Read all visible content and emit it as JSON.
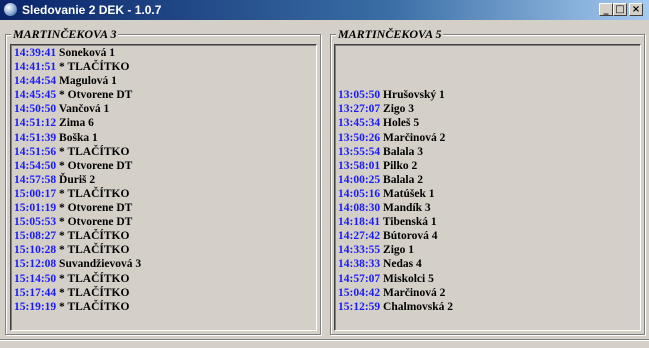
{
  "window": {
    "title": "Sledovanie 2 DEK - 1.0.7",
    "minimize": "_",
    "maximize": "□",
    "close": "×"
  },
  "left": {
    "label": "MARTINČEKOVA 3",
    "blank_top_rows": 0,
    "rows": [
      {
        "time": "14:39:41",
        "name": "Soneková 1"
      },
      {
        "time": "14:41:51",
        "name": "* TLAČÍTKO"
      },
      {
        "time": "14:44:54",
        "name": "Magulová 1"
      },
      {
        "time": "14:45:45",
        "name": "* Otvorene DT"
      },
      {
        "time": "14:50:50",
        "name": "Vančová 1"
      },
      {
        "time": "14:51:12",
        "name": "Zima 6"
      },
      {
        "time": "14:51:39",
        "name": "Boška 1"
      },
      {
        "time": "14:51:56",
        "name": "* TLAČÍTKO"
      },
      {
        "time": "14:54:50",
        "name": "* Otvorene DT"
      },
      {
        "time": "14:57:58",
        "name": "Ďuriš 2"
      },
      {
        "time": "15:00:17",
        "name": "* TLAČÍTKO"
      },
      {
        "time": "15:01:19",
        "name": "* Otvorene DT"
      },
      {
        "time": "15:05:53",
        "name": "* Otvorene DT"
      },
      {
        "time": "15:08:27",
        "name": "* TLAČÍTKO"
      },
      {
        "time": "15:10:28",
        "name": "* TLAČÍTKO"
      },
      {
        "time": "15:12:08",
        "name": "Suvandžievová 3"
      },
      {
        "time": "15:14:50",
        "name": "* TLAČÍTKO"
      },
      {
        "time": "15:17:44",
        "name": "* TLAČÍTKO"
      },
      {
        "time": "15:19:19",
        "name": "* TLAČÍTKO"
      }
    ]
  },
  "right": {
    "label": "MARTINČEKOVA 5",
    "blank_top_rows": 3,
    "rows": [
      {
        "time": "13:05:50",
        "name": "Hrušovský 1"
      },
      {
        "time": "13:27:07",
        "name": "Zigo 3"
      },
      {
        "time": "13:45:34",
        "name": "Holeš 5"
      },
      {
        "time": "13:50:26",
        "name": "Marčinová 2"
      },
      {
        "time": "13:55:54",
        "name": "Balala 3"
      },
      {
        "time": "13:58:01",
        "name": "Pilko 2"
      },
      {
        "time": "14:00:25",
        "name": "Balala 2"
      },
      {
        "time": "14:05:16",
        "name": "Matúšek 1"
      },
      {
        "time": "14:08:30",
        "name": "Mandík 3"
      },
      {
        "time": "14:18:41",
        "name": "Tibenská 1"
      },
      {
        "time": "14:27:42",
        "name": "Bútorová 4"
      },
      {
        "time": "14:33:55",
        "name": "Zigo 1"
      },
      {
        "time": "14:38:33",
        "name": "Nedas 4"
      },
      {
        "time": "14:57:07",
        "name": "Miskolci 5"
      },
      {
        "time": "15:04:42",
        "name": "Marčinová 2"
      },
      {
        "time": "15:12:59",
        "name": "Chalmovská 2"
      }
    ]
  }
}
